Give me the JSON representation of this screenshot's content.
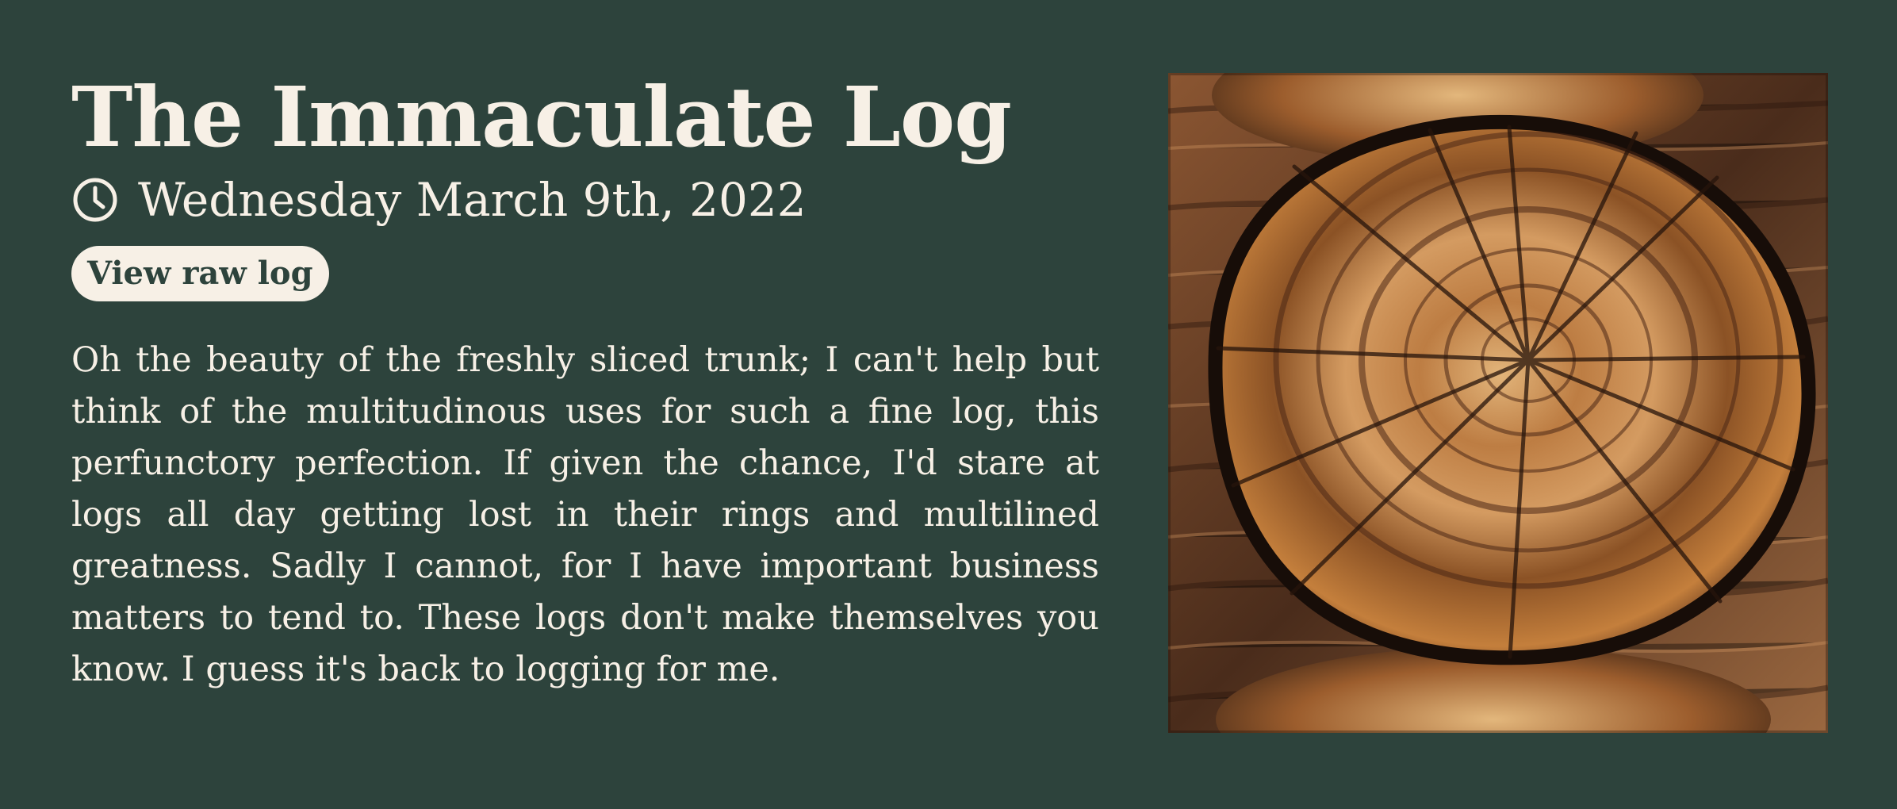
{
  "post": {
    "title": "The Immaculate Log",
    "date": "Wednesday March 9th, 2022",
    "view_raw_label": "View raw log",
    "body": "Oh the beauty of the freshly sliced trunk; I can't help but think of the multitudinous uses for such a fine log, this perfunctory perfection. If given the chance, I'd stare at logs all day getting lost in their rings and multilined greatness. Sadly I cannot, for I have important business matters to tend to. These logs don't make themselves you know. I guess it's back to logging for me."
  },
  "icons": {
    "date": "clock-icon"
  },
  "colors": {
    "background": "#2d433c",
    "text": "#f7f0e6",
    "button_background": "#f7f0e6",
    "button_text": "#2d433c"
  }
}
